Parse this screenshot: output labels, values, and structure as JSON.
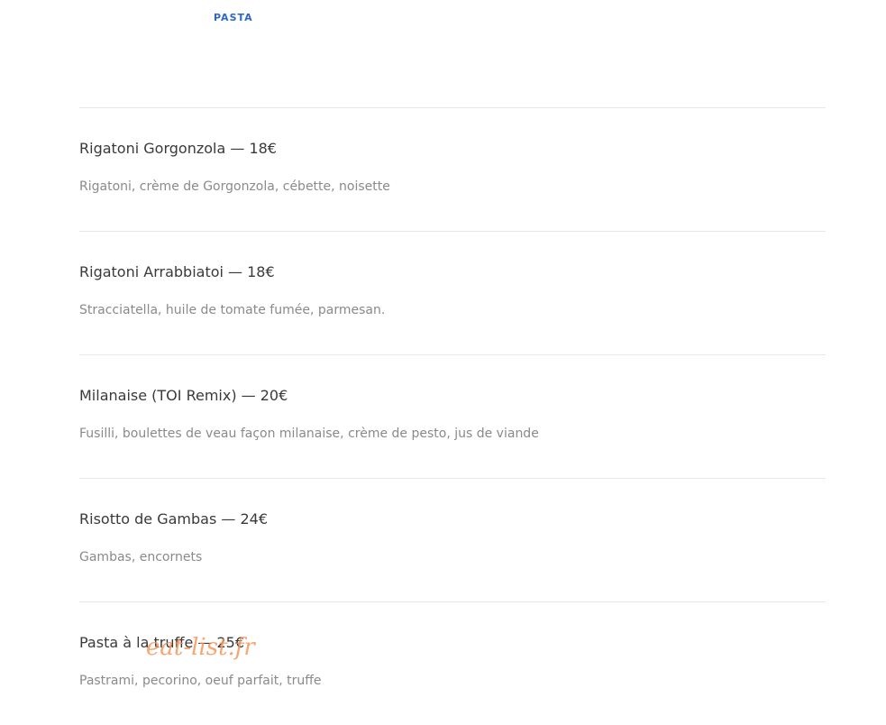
{
  "tab": {
    "label": "PASTA"
  },
  "menu": {
    "items": [
      {
        "title": "Rigatoni Gorgonzola — 18€",
        "description": "Rigatoni, crème de Gorgonzola, cébette, noisette"
      },
      {
        "title": "Rigatoni Arrabbiatoi — 18€",
        "description": "Stracciatella, huile de tomate fumée, parmesan."
      },
      {
        "title": "Milanaise (TOI Remix) — 20€",
        "description": "Fusilli, boulettes de veau façon milanaise, crème de pesto, jus de viande"
      },
      {
        "title": "Risotto de Gambas — 24€",
        "description": "Gambas, encornets"
      },
      {
        "title": "Pasta à la truffe — 25€",
        "description": "Pastrami, pecorino, oeuf parfait, truffe"
      }
    ]
  },
  "watermark": {
    "text": "eat-list.fr"
  },
  "colors": {
    "tab_accent": "#2f67c8",
    "title": "#3a3a3a",
    "description": "#8a8a8a",
    "divider": "#e8e8e8",
    "watermark": "#f5965a"
  }
}
